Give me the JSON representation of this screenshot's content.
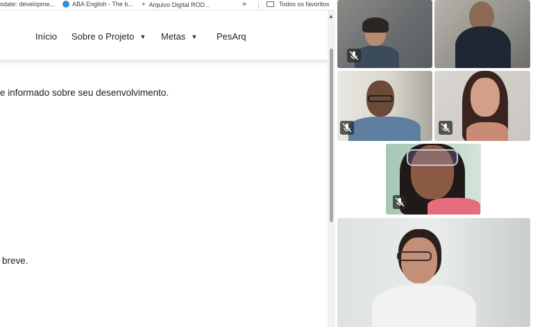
{
  "bookmarks": [
    {
      "label": "odate: developme...",
      "icon": "page-icon"
    },
    {
      "label": "ABA English - The b...",
      "icon": "globe-icon",
      "color": "#3a8fd6"
    },
    {
      "label": "Arquivo Digital ROD...",
      "icon": "archive-icon",
      "color": "#b58a4a"
    }
  ],
  "bookmarks_more": "»",
  "all_bookmarks": "Todos os favoritos",
  "nav": {
    "inicio": "Início",
    "sobre": "Sobre o Projeto",
    "metas": "Metas",
    "pesarq": "PesArq",
    "caret": "▼"
  },
  "content": {
    "line1": "e informado sobre seu desenvolvimento.",
    "line2": "breve."
  },
  "scroll_up": "▲",
  "participants": [
    {
      "id": "p1",
      "muted": true
    },
    {
      "id": "p2",
      "muted": false
    },
    {
      "id": "p3",
      "muted": true
    },
    {
      "id": "p4",
      "muted": true
    },
    {
      "id": "p5",
      "muted": true
    },
    {
      "id": "p6",
      "muted": false
    }
  ],
  "colors": {
    "accent": "#3a8fd6",
    "mute_bg": "#282828"
  }
}
